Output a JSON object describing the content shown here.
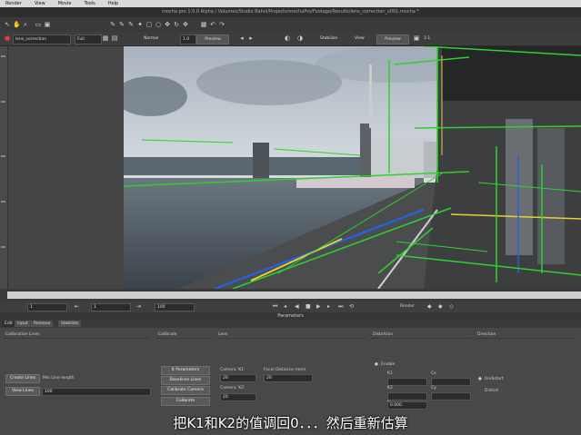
{
  "menu": [
    "Render",
    "View",
    "Movie",
    "Tools",
    "Help"
  ],
  "window_title": "mocha pro 1.0.0 Alpha / Volumes/Studio Bahnl/Projects/mochaPro/Footage/Results/lens_correction_v001.mocha *",
  "toolbar": {
    "layer_select": "lens_correction",
    "view_select": "Full",
    "mode_label": "Normal",
    "view_value": "1.0",
    "track_button": "Preview",
    "stabilize_label": "Stabilize",
    "view_label": "View",
    "view_mode_button": "Preview",
    "zoom_label": "1:1"
  },
  "transport": {
    "field_left": "1",
    "field_mid": "1",
    "field_right": "100",
    "render_label": "Render"
  },
  "parameters_title": "Parameters",
  "tabs": [
    "Edit",
    "Input",
    "Remove",
    "Stabilize"
  ],
  "sections": {
    "calibration_lines": "Calibration Lines",
    "calibrate": "Calibrate",
    "lens": "Lens",
    "distortion": "Distortion",
    "direction": "Direction"
  },
  "calibration": {
    "create_lines_button": "Create Lines",
    "min_line_length_label": "Min Line length",
    "view_lines_button": "View Lines",
    "view_lines_value": "100"
  },
  "calibrate": {
    "parameters_button": "K Parameters",
    "baselines_button": "Baselines Lines",
    "calibrate_camera_button": "Calibrate Camera",
    "calibrate_button": "Calibrate"
  },
  "lens": {
    "k1_label": "Camera 'K1'",
    "k1_value": "20",
    "focal_label": "Focal Distance (mm)",
    "focal_value": "20",
    "k2_label": "Camera 'K2'",
    "k2_value": "20"
  },
  "distortion": {
    "enable_label": "Enable",
    "k1_label": "K1",
    "k2_label": "K2",
    "k_label": "K",
    "cx_label": "Cx",
    "cy_label": "Cy",
    "k_value": "0.000"
  },
  "direction": {
    "undistort_label": "Undistort",
    "distort_label": "Distort"
  },
  "subtitle": "把K1和K2的值调回0．．．然后重新估算",
  "colors": {
    "line_green": "#2fd12f",
    "line_blue": "#2a5fd6",
    "line_yellow": "#e8d030",
    "line_white": "#e8e8e8"
  }
}
